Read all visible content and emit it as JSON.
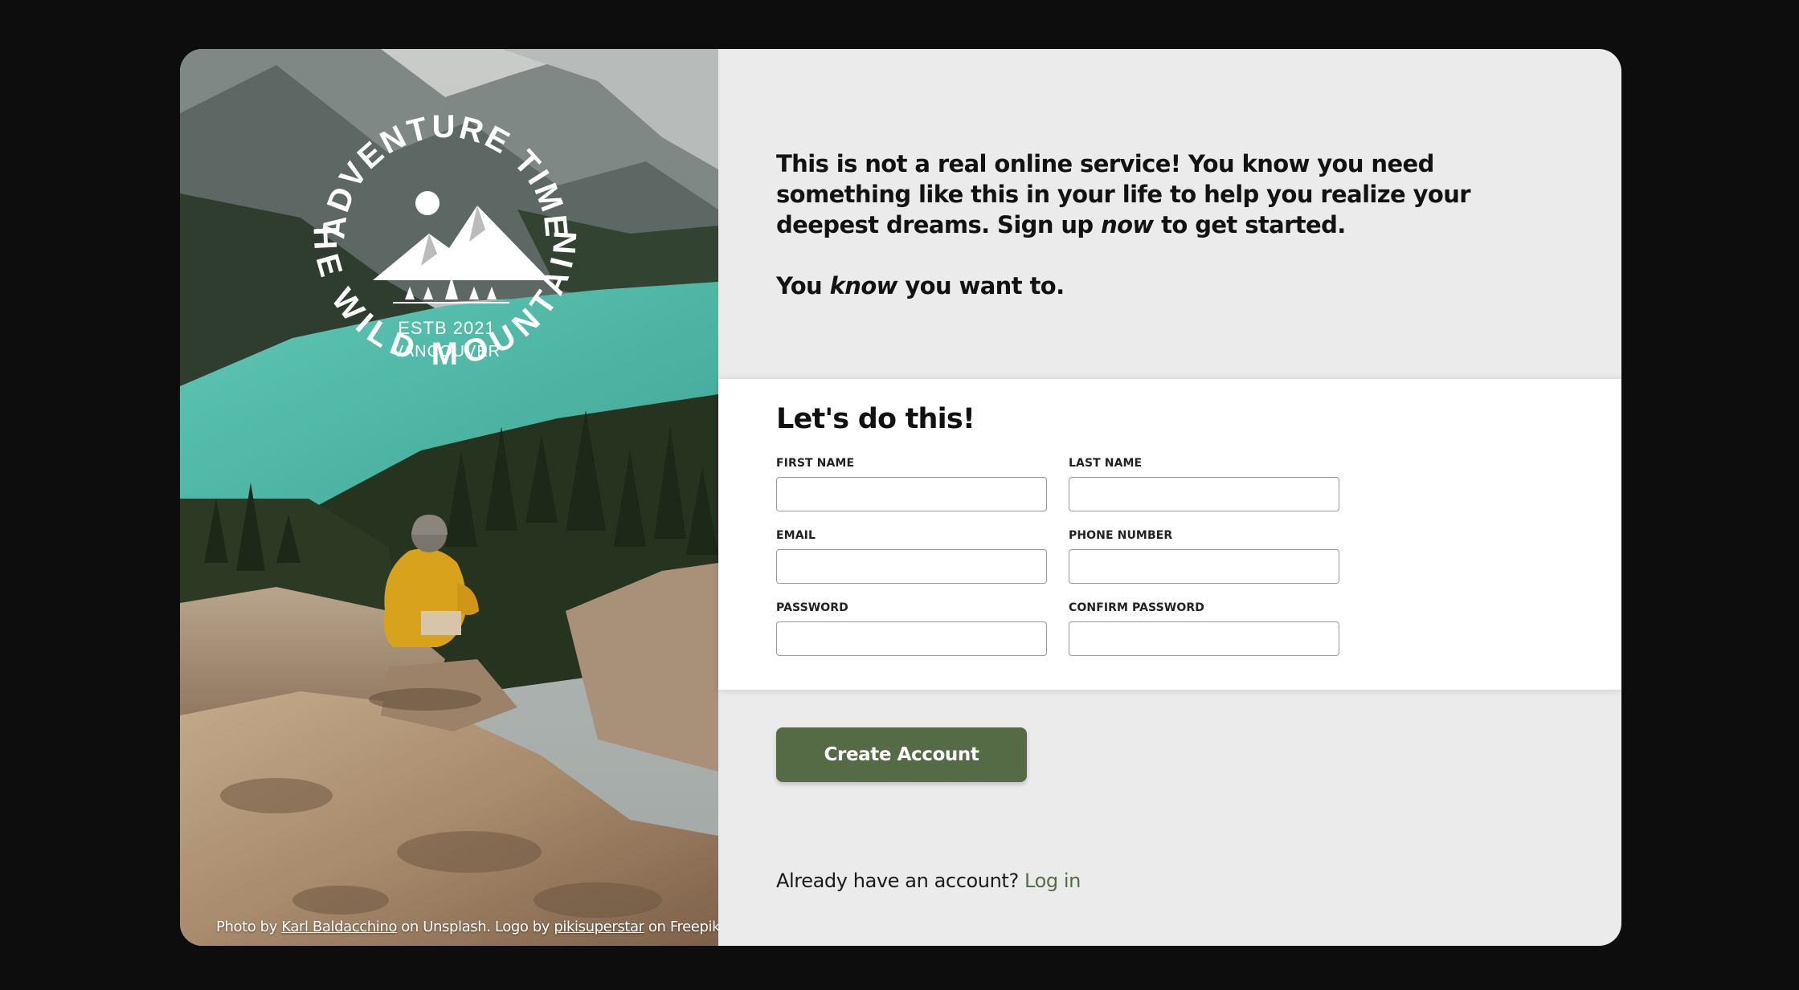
{
  "logo": {
    "arc_top": "ADVENTURE TIME",
    "arc_bottom": "THE WILD MOUNTAINS",
    "line1": "ESTB 2021",
    "line2": "VANCOUVER"
  },
  "credit": {
    "prefix": "Photo by ",
    "photographer": "Karl Baldacchino",
    "middle": " on Unsplash. Logo by ",
    "logo_author": "pikisuperstar",
    "suffix": " on Freepik."
  },
  "intro": {
    "p1_a": "This is not a real online service! You know you need something like this in your life to help you realize your deepest dreams. Sign up ",
    "p1_em": "now",
    "p1_b": " to get started.",
    "p2_a": "You ",
    "p2_em": "know",
    "p2_b": " you want to."
  },
  "form": {
    "title": "Let's do this!",
    "first_name_label": "First Name",
    "last_name_label": "Last Name",
    "email_label": "Email",
    "phone_label": "Phone Number",
    "password_label": "Password",
    "confirm_password_label": "Confirm Password",
    "first_name_value": "",
    "last_name_value": "",
    "email_value": "",
    "phone_value": "",
    "password_value": "",
    "confirm_password_value": ""
  },
  "actions": {
    "create_account_label": "Create Account",
    "login_prompt": "Already have an account? ",
    "login_link": "Log in"
  },
  "colors": {
    "accent": "#556b45",
    "page_background": "#0d0d0d",
    "card_background": "#ebebeb",
    "form_background": "#ffffff"
  }
}
